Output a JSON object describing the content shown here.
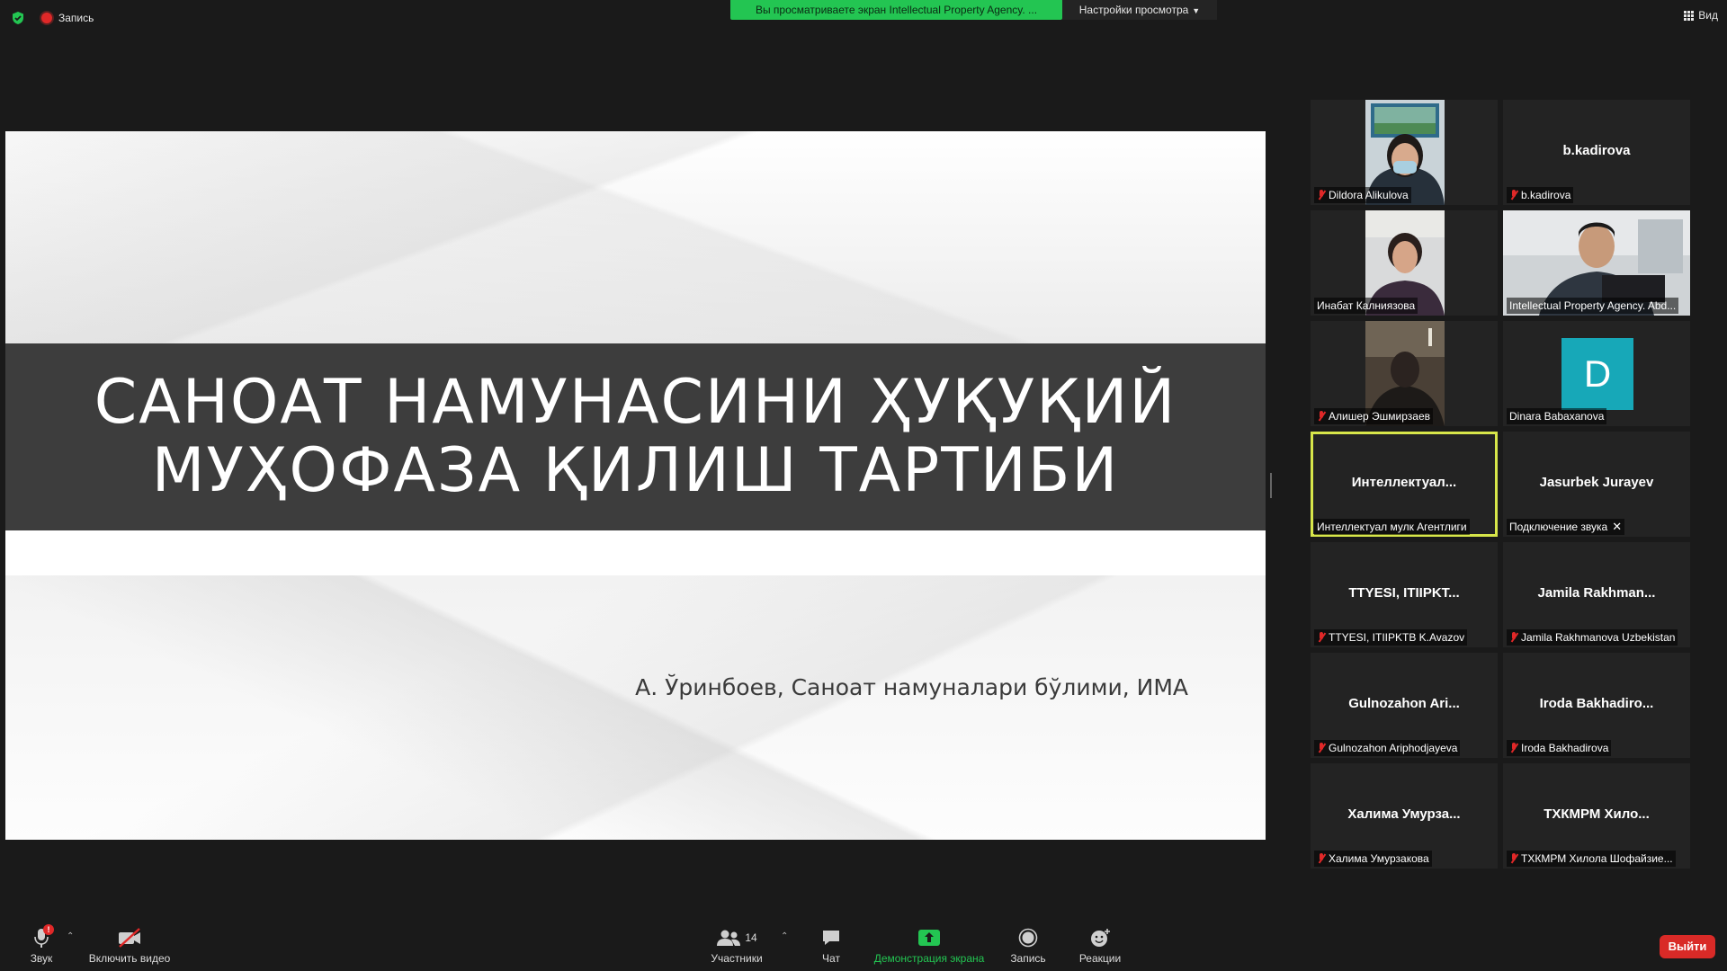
{
  "app": {
    "recording_label": "Запись",
    "share_banner": "Вы просматриваете экран Intellectual Property Agency. ...",
    "view_options": "Настройки просмотра",
    "view_button": "Вид"
  },
  "slide": {
    "title_line1": "САНОАТ НАМУНАСИНИ ҲУҚУҚИЙ",
    "title_line2": "МУҲОФАЗА ҚИЛИШ ТАРТИБИ",
    "author": "А. Ўринбоев, Саноат намуналари бўлими, ИМА",
    "band_color": "#3d3d3d"
  },
  "participants": [
    {
      "display": "",
      "label": "Dildora Alikulova",
      "muted": true,
      "video": true
    },
    {
      "display": "b.kadirova",
      "label": "b.kadirova",
      "muted": true,
      "video": false
    },
    {
      "display": "",
      "label": "Инабат Калниязова",
      "muted": false,
      "video": true
    },
    {
      "display": "",
      "label": "Intellectual Property Agency. Abd...",
      "muted": false,
      "video": true
    },
    {
      "display": "",
      "label": "Алишер Эшмирзаев",
      "muted": true,
      "video": true
    },
    {
      "display": "D",
      "label": "Dinara Babaxanova",
      "muted": false,
      "video": false
    },
    {
      "display": "Интеллектуал...",
      "label": "Интеллектуал мулк  Агентлиги",
      "muted": false,
      "video": false,
      "active": true
    },
    {
      "display": "Jasurbek Jurayev",
      "label": "Подключение звука",
      "muted": false,
      "video": false
    },
    {
      "display": "TTYESI, ITIIPKT...",
      "label": "TTYESI, ITIIPKTB K.Avazov",
      "muted": true,
      "video": false
    },
    {
      "display": "Jamila  Rakhman...",
      "label": "Jamila Rakhmanova Uzbekistan",
      "muted": true,
      "video": false
    },
    {
      "display": "Gulnozahon  Ari...",
      "label": "Gulnozahon Ariphodjayeva",
      "muted": true,
      "video": false
    },
    {
      "display": "Iroda  Bakhadiro...",
      "label": "Iroda Bakhadirova",
      "muted": true,
      "video": false
    },
    {
      "display": "Халима  Умурза...",
      "label": "Халима Умурзакова",
      "muted": true,
      "video": false
    },
    {
      "display": "ТХКМРМ  Хило...",
      "label": "ТХКМРМ Хилола Шофайзие...",
      "muted": true,
      "video": false
    }
  ],
  "toolbar": {
    "audio": "Звук",
    "audio_badge": "!",
    "video": "Включить видео",
    "participants": "Участники",
    "participants_count": "14",
    "chat": "Чат",
    "share": "Демонстрация экрана",
    "record": "Запись",
    "reactions": "Реакции",
    "leave": "Выйти"
  },
  "colors": {
    "banner": "#23c552",
    "active_speaker": "#d7e64a",
    "leave": "#d92a27",
    "avatar_d": "#17a8b8"
  }
}
